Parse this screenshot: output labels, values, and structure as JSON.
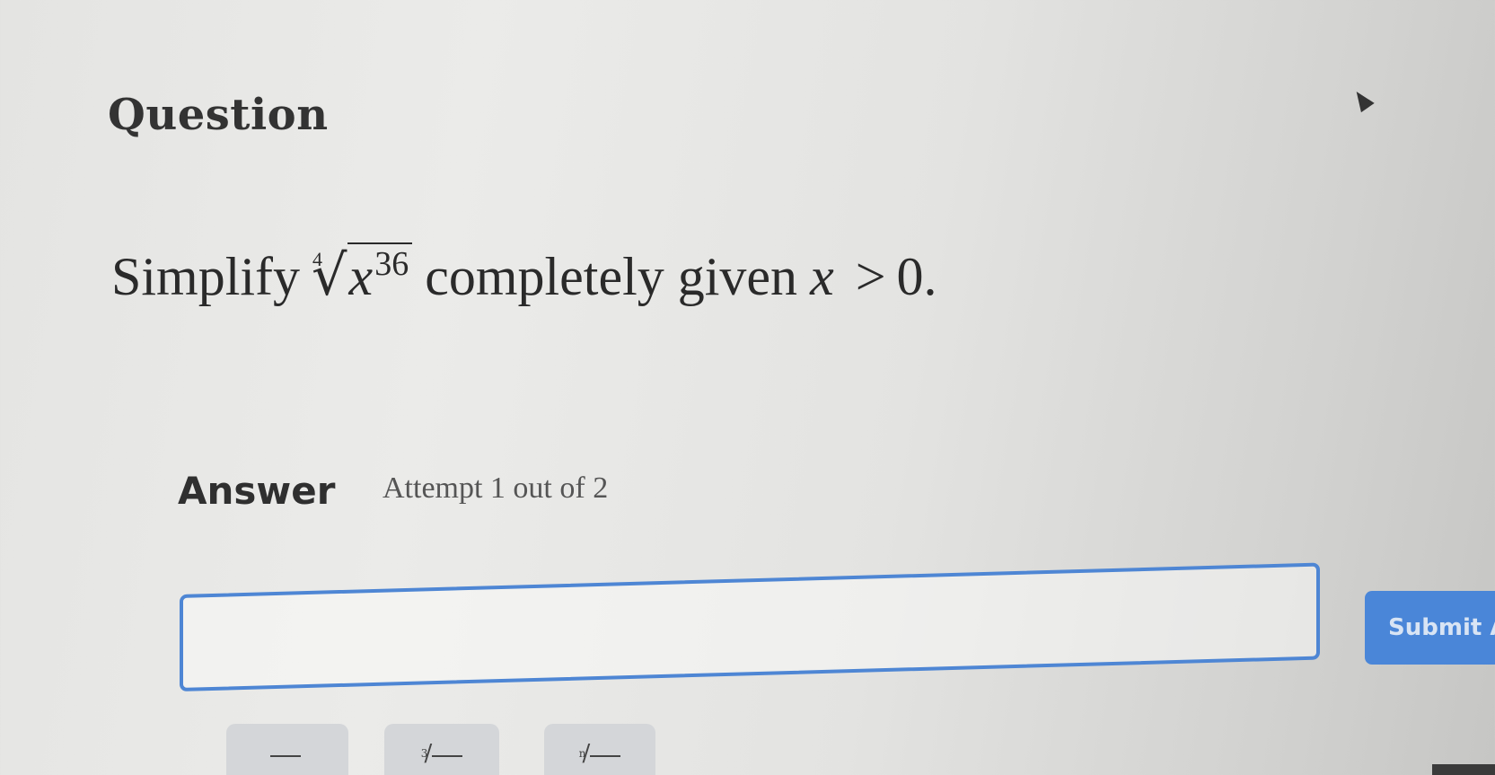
{
  "question": {
    "heading": "Question",
    "prefix": "Simplify",
    "root_index": "4",
    "radicand_base": "x",
    "radicand_exponent": "36",
    "middle": "completely given",
    "condition_var": "x",
    "condition_op": ">",
    "condition_value": "0."
  },
  "answer": {
    "heading": "Answer",
    "attempt": "Attempt 1 out of 2",
    "input_value": "",
    "submit_label": "Submit A"
  },
  "toolbar": {
    "buttons": [
      {
        "icon": "square-root-icon",
        "index": ""
      },
      {
        "icon": "cube-root-icon",
        "index": "3"
      },
      {
        "icon": "nth-root-icon",
        "index": "n"
      }
    ]
  },
  "colors": {
    "accent": "#4a86d8",
    "input_border": "#4e86d4"
  }
}
